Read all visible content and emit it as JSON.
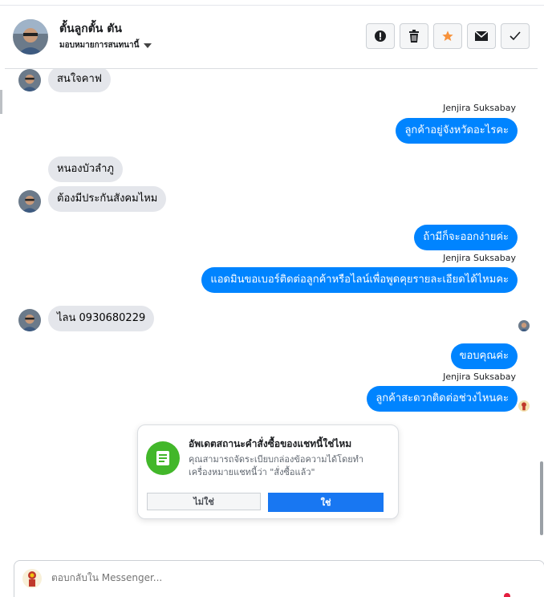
{
  "header": {
    "name": "ตั้นลูกตั้น ตัน",
    "assign_label": "มอบหมายการสนทนานี้",
    "actions": [
      {
        "name": "mark-spam-button",
        "icon": "alert-circle-icon"
      },
      {
        "name": "delete-button",
        "icon": "trash-icon"
      },
      {
        "name": "star-button",
        "icon": "star-icon",
        "color": "#f7923b"
      },
      {
        "name": "mark-unread-button",
        "icon": "envelope-icon"
      },
      {
        "name": "mark-done-button",
        "icon": "check-icon"
      }
    ]
  },
  "messages": {
    "m1": "สนใจคาฟ",
    "sender1": "Jenjira Suksabay",
    "m2": "ลูกค้าอยู่จังหวัดอะไรคะ",
    "m3": "หนองบัวลำภู",
    "m4": "ต้องมีประกันสังคมไหม",
    "m5": "ถ้ามีก็จะออกง่ายค่ะ",
    "sender2": "Jenjira Suksabay",
    "m6": "แอดมินขอเบอร์ติดต่อลูกค้าหรือไลน์เพื่อพูดคุยรายละเอียดได้ไหมคะ",
    "m7": "ไลน 0930680229",
    "m8": "ขอบคุณค่ะ",
    "sender3": "Jenjira Suksabay",
    "m9": "ลูกค้าสะดวกติดต่อช่วงไหนคะ"
  },
  "prompt": {
    "title": "อัพเดตสถานะคำสั่งซื้อของแชทนี้ใช่ไหม",
    "body": "คุณสามารถจัดระเบียบกล่องข้อความได้โดยทำเครื่องหมายแชทนี้ว่า \"สั่งซื้อแล้ว\"",
    "no_label": "ไม่ใช่",
    "yes_label": "ใช่"
  },
  "composer": {
    "placeholder": "ตอบกลับใน Messenger..."
  },
  "colors": {
    "outgoing": "#0084ff",
    "incoming": "#e4e6eb",
    "primary_button": "#1877f2",
    "prompt_icon": "#42b72a",
    "star": "#f7923b"
  }
}
